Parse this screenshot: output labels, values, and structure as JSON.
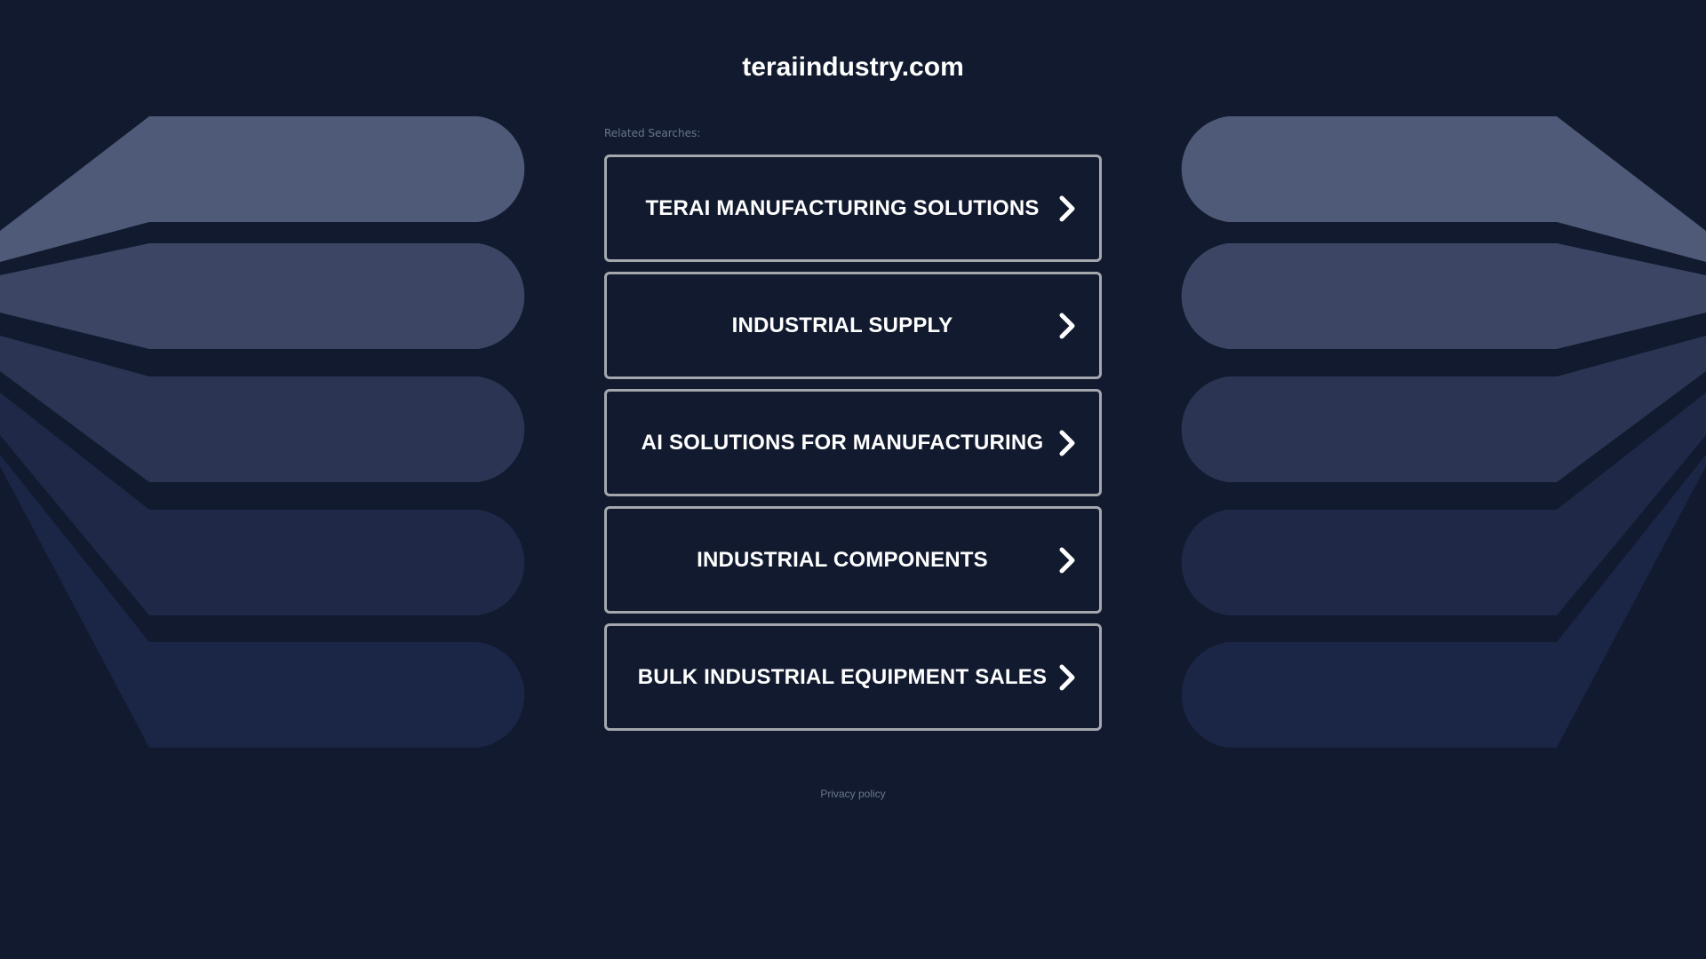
{
  "site": {
    "title": "teraiindustry.com"
  },
  "related": {
    "label": "Related Searches:"
  },
  "searches": [
    {
      "label": "TERAI MANUFACTURING SOLUTIONS"
    },
    {
      "label": "INDUSTRIAL SUPPLY"
    },
    {
      "label": "AI SOLUTIONS FOR MANUFACTURING"
    },
    {
      "label": "INDUSTRIAL COMPONENTS"
    },
    {
      "label": "BULK INDUSTRIAL EQUIPMENT SALES"
    }
  ],
  "footer": {
    "privacy_label": "Privacy policy"
  },
  "colors": {
    "background": "#111a2e",
    "button_border": "#a4a7ae",
    "text": "#ffffff",
    "muted_text": "#6b7590"
  },
  "icons": {
    "search_item_arrow": "chevron-right-icon"
  }
}
